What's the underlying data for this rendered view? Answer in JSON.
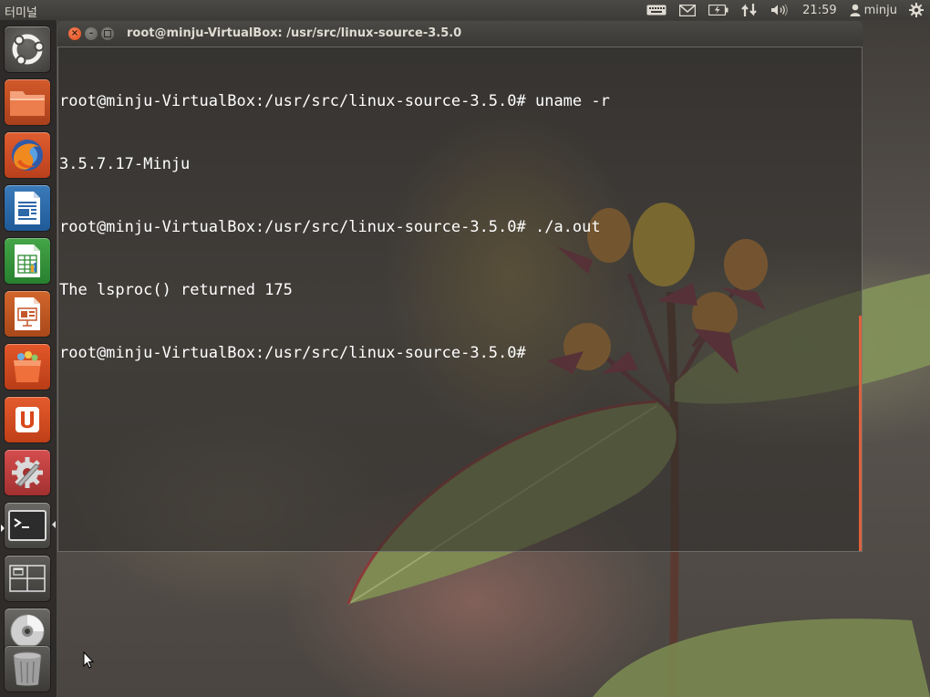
{
  "top_panel": {
    "app_title": "터미널",
    "clock": "21:59",
    "user": "minju",
    "icons": [
      "keyboard-icon",
      "mail-icon",
      "battery-icon",
      "network-icon",
      "volume-icon",
      "user-icon",
      "gear-icon"
    ]
  },
  "launcher": {
    "items": [
      {
        "name": "dash-home",
        "icon": "ubuntu-logo-icon"
      },
      {
        "name": "files",
        "icon": "folder-icon"
      },
      {
        "name": "firefox",
        "icon": "firefox-icon"
      },
      {
        "name": "libreoffice-writer",
        "icon": "writer-icon"
      },
      {
        "name": "libreoffice-calc",
        "icon": "calc-icon"
      },
      {
        "name": "libreoffice-impress",
        "icon": "impress-icon"
      },
      {
        "name": "software-center",
        "icon": "shopping-bag-icon"
      },
      {
        "name": "ubuntu-one",
        "icon": "ubuntu-one-icon"
      },
      {
        "name": "system-settings",
        "icon": "settings-icon"
      },
      {
        "name": "terminal",
        "icon": "terminal-icon",
        "active": true
      },
      {
        "name": "workspace-switcher",
        "icon": "workspace-icon"
      },
      {
        "name": "disc",
        "icon": "cd-icon"
      },
      {
        "name": "trash",
        "icon": "trash-icon"
      }
    ]
  },
  "terminal": {
    "title": "root@minju-VirtualBox: /usr/src/linux-source-3.5.0",
    "lines": [
      "root@minju-VirtualBox:/usr/src/linux-source-3.5.0# uname -r",
      "3.5.7.17-Minju",
      "root@minju-VirtualBox:/usr/src/linux-source-3.5.0# ./a.out",
      "The lsproc() returned 175",
      "root@minju-VirtualBox:/usr/src/linux-source-3.5.0#"
    ]
  },
  "colors": {
    "accent": "#df4a16",
    "panel": "#3c3b37",
    "terminal_text": "#ffffff"
  }
}
